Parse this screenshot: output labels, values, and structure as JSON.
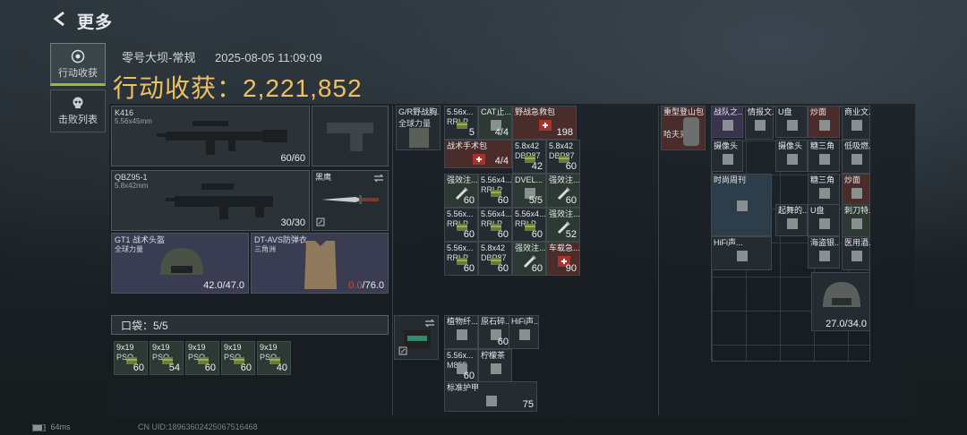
{
  "header": {
    "title": "更多"
  },
  "sidebar": {
    "tabs": [
      {
        "label": "行动收获",
        "icon": "target-icon"
      },
      {
        "label": "击败列表",
        "icon": "skull-icon"
      }
    ]
  },
  "info": {
    "map": "零号大坝-常规",
    "datetime": "2025-08-05 11:09:09"
  },
  "haul": {
    "label": "行动收获：",
    "value": "2,221,852"
  },
  "equipment": {
    "primary1": {
      "name": "K416",
      "caliber": "5.56x45mm",
      "ammo": "60/60"
    },
    "primary2": {
      "name": "QBZ95-1",
      "caliber": "5.8x42mm",
      "ammo": "30/30"
    },
    "melee": {
      "name": "黑鹰"
    },
    "helmet": {
      "name": "GT1 战术头盔",
      "tag": "全球力量",
      "durability": "42.0/47.0"
    },
    "armor": {
      "name": "DT-AVS防弹衣",
      "tag": "三角洲",
      "durability_cur": "0.0",
      "durability_max": "/76.0"
    }
  },
  "pocket": {
    "label": "口袋：5/5",
    "items": [
      {
        "name": "9x19",
        "sub": "PSO",
        "qty": "60"
      },
      {
        "name": "9x19",
        "sub": "PSO",
        "qty": "54"
      },
      {
        "name": "9x19",
        "sub": "PSO",
        "qty": "60"
      },
      {
        "name": "9x19",
        "sub": "PSO",
        "qty": "60"
      },
      {
        "name": "9x19",
        "sub": "PSO",
        "qty": "40"
      }
    ]
  },
  "chest": {
    "rig": {
      "name": "G/R野战胸...",
      "tag": "全球力量"
    },
    "items": [
      {
        "name": "5.56x...",
        "sub": "RRLP",
        "qty": "5"
      },
      {
        "name": "CAT止...",
        "qty": "4/4"
      },
      {
        "name": "野战急救包",
        "qty": "198"
      },
      {
        "name": "战术手术包",
        "qty": "4/4"
      },
      {
        "name": "5.8x42",
        "sub": "DBP87",
        "qty": "42"
      },
      {
        "name": "5.8x42",
        "sub": "DBP87",
        "qty": "60"
      },
      {
        "name": "强效注...",
        "qty": "60"
      },
      {
        "name": "5.56x4...",
        "sub": "RRLP",
        "qty": "60"
      },
      {
        "name": "DVEL...",
        "qty": "5/5"
      },
      {
        "name": "强效注...",
        "qty": "60"
      },
      {
        "name": "5.56x...",
        "sub": "RRLP",
        "qty": "60"
      },
      {
        "name": "5.56x4...",
        "sub": "RRLP",
        "qty": "60"
      },
      {
        "name": "5.56x4...",
        "sub": "RRLP",
        "qty": "60"
      },
      {
        "name": "强效注...",
        "qty": "52"
      },
      {
        "name": "5.56x...",
        "sub": "RRLP",
        "qty": "60"
      },
      {
        "name": "5.8x42",
        "sub": "DBP87",
        "qty": "60"
      },
      {
        "name": "强效注...",
        "qty": "60"
      },
      {
        "name": "车载急...",
        "qty": "90"
      }
    ]
  },
  "bag": {
    "items": [
      {
        "name": "植物纤..."
      },
      {
        "name": "原石碎...",
        "qty": "60"
      },
      {
        "name": "HiFi声..."
      },
      {
        "name": "5.56x...",
        "sub": "M855",
        "qty": "60"
      },
      {
        "name": "柠檬茶"
      },
      {
        "name": "标准护甲",
        "qty": "75"
      }
    ]
  },
  "backpack": {
    "item": {
      "name": "重型登山包",
      "tag": "哈夫克"
    },
    "items": [
      {
        "name": "战队之..."
      },
      {
        "name": "情报文..."
      },
      {
        "name": "U盘"
      },
      {
        "name": "炒面"
      },
      {
        "name": "商业文..."
      },
      {
        "name": "摄像头"
      },
      {
        "name": "摄像头"
      },
      {
        "name": "糖三角"
      },
      {
        "name": "低吸燃..."
      },
      {
        "name": "时尚周刊"
      },
      {
        "name": "糖三角"
      },
      {
        "name": "炒面"
      },
      {
        "name": "起舞的..."
      },
      {
        "name": "U盘"
      },
      {
        "name": "刺刀特..."
      },
      {
        "name": "HiFi声..."
      },
      {
        "name": "海盗银..."
      },
      {
        "name": "医用酒..."
      }
    ],
    "helmet_durability": "27.0/34.0"
  },
  "status": {
    "ping": "64ms",
    "uid": "CN UID:1896360242506751646​8"
  }
}
